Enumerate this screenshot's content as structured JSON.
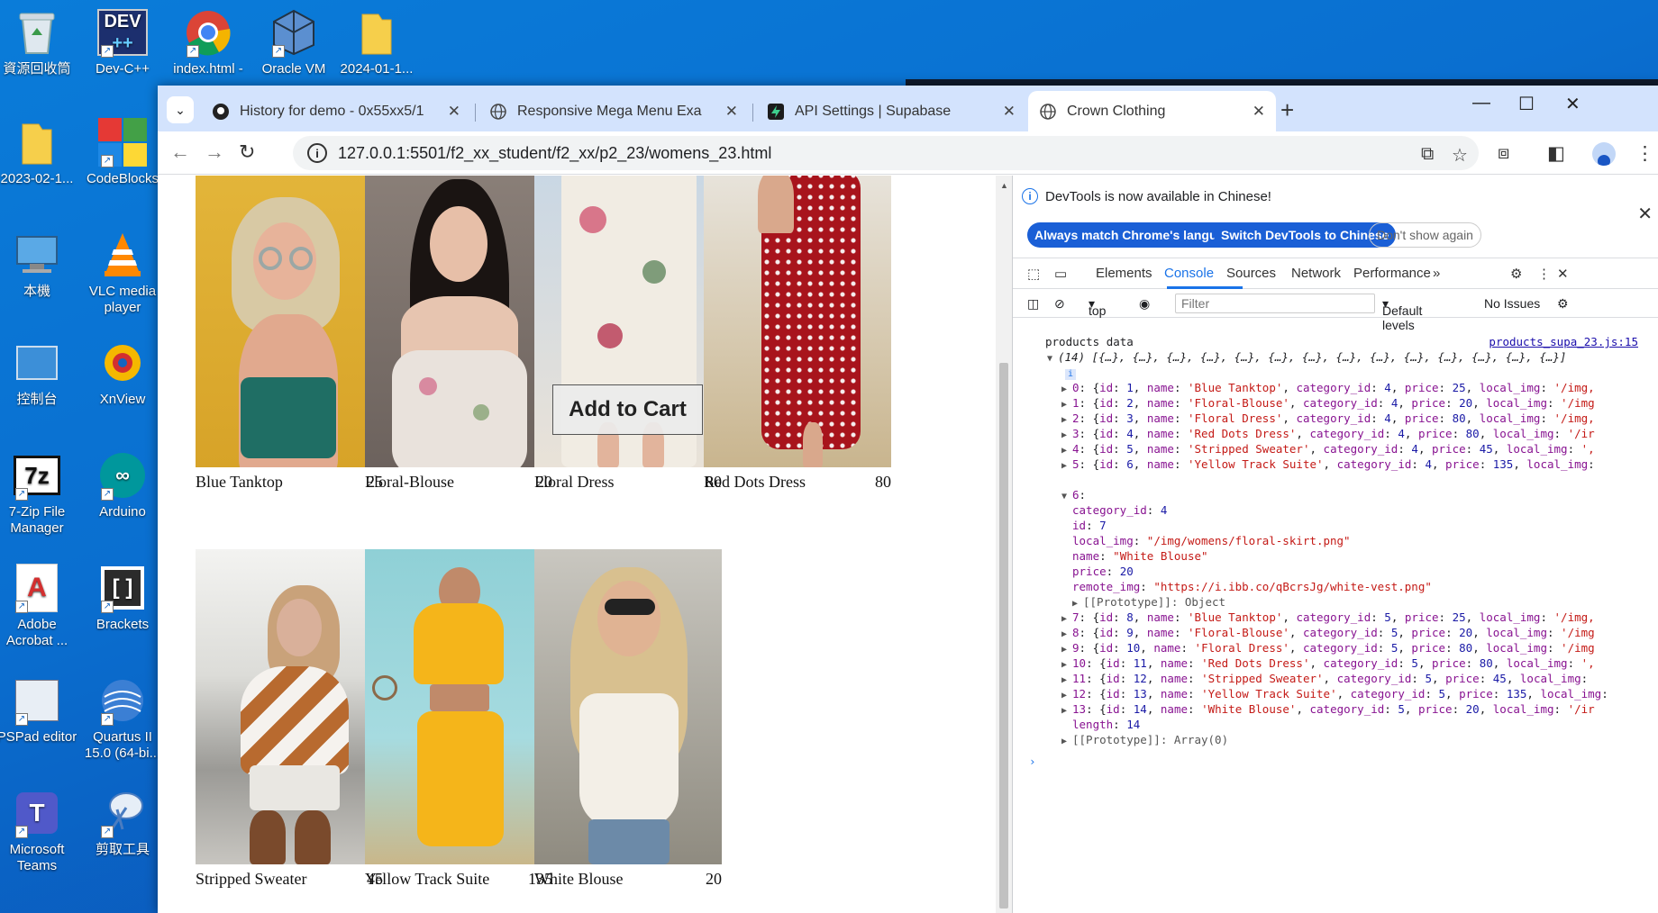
{
  "desktop": {
    "icons": [
      {
        "label": "資源回收筒",
        "icon": "recycle-bin-icon"
      },
      {
        "label": "Dev-C++",
        "icon": "devcpp-icon"
      },
      {
        "label": "index.html - 捷徑",
        "icon": "chrome-icon"
      },
      {
        "label": "Oracle VM VirtualBox",
        "icon": "virtualbox-icon"
      },
      {
        "label": "2024-01-1...",
        "icon": "folder-icon"
      },
      {
        "label": "2023-02-1...",
        "icon": "folder-icon"
      },
      {
        "label": "CodeBlocks",
        "icon": "codeblocks-icon"
      },
      {
        "label": "本機",
        "icon": "computer-icon"
      },
      {
        "label": "VLC media player",
        "icon": "vlc-icon"
      },
      {
        "label": "控制台",
        "icon": "control-panel-icon"
      },
      {
        "label": "XnView",
        "icon": "xnview-icon"
      },
      {
        "label": "7-Zip File Manager",
        "icon": "7zip-icon"
      },
      {
        "label": "Arduino",
        "icon": "arduino-icon"
      },
      {
        "label": "Adobe Acrobat ...",
        "icon": "acrobat-icon"
      },
      {
        "label": "Brackets",
        "icon": "brackets-icon"
      },
      {
        "label": "PSPad editor",
        "icon": "pspad-icon"
      },
      {
        "label": "Quartus II 15.0 (64-bi...",
        "icon": "quartus-icon"
      },
      {
        "label": "Microsoft Teams",
        "icon": "teams-icon"
      },
      {
        "label": "剪取工具",
        "icon": "snipping-tool-icon"
      }
    ]
  },
  "browser": {
    "tabs": [
      {
        "title": "History for demo - 0x55xx5/1",
        "icon": "github-icon"
      },
      {
        "title": "Responsive Mega Menu Exam",
        "icon": "globe-icon"
      },
      {
        "title": "API Settings | Supabase",
        "icon": "supabase-icon"
      },
      {
        "title": "Crown Clothing",
        "icon": "globe-icon",
        "active": true
      }
    ],
    "url": "127.0.0.1:5501/f2_xx_student/f2_xx/p2_23/womens_23.html"
  },
  "products": [
    {
      "name": "Blue Tanktop",
      "price": "25"
    },
    {
      "name": "Floral-Blouse",
      "price": "20"
    },
    {
      "name": "Floral Dress",
      "price": "80"
    },
    {
      "name": "Red Dots Dress",
      "price": "80"
    },
    {
      "name": "Stripped Sweater",
      "price": "45"
    },
    {
      "name": "Yellow Track Suite",
      "price": "135"
    },
    {
      "name": "White Blouse",
      "price": "20"
    }
  ],
  "add_to_cart": "Add to Cart",
  "devtools": {
    "banner": "DevTools is now available in Chinese!",
    "btn_match": "Always match Chrome's language",
    "btn_switch": "Switch DevTools to Chinese",
    "btn_dismiss": "Don't show again",
    "tabs": [
      "Elements",
      "Console",
      "Sources",
      "Network",
      "Performance"
    ],
    "context": "top",
    "filter_placeholder": "Filter",
    "levels": "Default levels",
    "issues": "No Issues",
    "console": {
      "label": "products data",
      "source": "products_supa_23.js:15",
      "array_summary": "(14) [{…}, {…}, {…}, {…}, {…}, {…}, {…}, {…}, {…}, {…}, {…}, {…}, {…}, {…}]",
      "info_badge": "i",
      "length": "14",
      "proto_array": "[[Prototype]]: Array(0)",
      "proto_object": "[[Prototype]]: Object",
      "rows_a": [
        {
          "idx": "0",
          "id": "1",
          "name": "Blue Tanktop",
          "cat": "4",
          "price": "25",
          "tail": "'/img,"
        },
        {
          "idx": "1",
          "id": "2",
          "name": "Floral-Blouse",
          "cat": "4",
          "price": "20",
          "tail": "'/img"
        },
        {
          "idx": "2",
          "id": "3",
          "name": "Floral Dress",
          "cat": "4",
          "price": "80",
          "tail": "'/img,"
        },
        {
          "idx": "3",
          "id": "4",
          "name": "Red Dots Dress",
          "cat": "4",
          "price": "80",
          "tail": "'/ir"
        },
        {
          "idx": "4",
          "id": "5",
          "name": "Stripped Sweater",
          "cat": "4",
          "price": "45",
          "tail": "',"
        },
        {
          "idx": "5",
          "id": "6",
          "name": "Yellow Track Suite",
          "cat": "4",
          "price": "135",
          "tail": ""
        }
      ],
      "expanded": {
        "idx": "6",
        "category_id": "4",
        "id": "7",
        "local_img": "\"/img/womens/floral-skirt.png\"",
        "name": "\"White Blouse\"",
        "price": "20",
        "remote_img": "\"https://i.ibb.co/qBcrsJg/white-vest.png\""
      },
      "rows_b": [
        {
          "idx": "7",
          "id": "8",
          "name": "Blue Tanktop",
          "cat": "5",
          "price": "25",
          "tail": "'/img,"
        },
        {
          "idx": "8",
          "id": "9",
          "name": "Floral-Blouse",
          "cat": "5",
          "price": "20",
          "tail": "'/img"
        },
        {
          "idx": "9",
          "id": "10",
          "name": "Floral Dress",
          "cat": "5",
          "price": "80",
          "tail": "'/img"
        },
        {
          "idx": "10",
          "id": "11",
          "name": "Red Dots Dress",
          "cat": "5",
          "price": "80",
          "tail": "',"
        },
        {
          "idx": "11",
          "id": "12",
          "name": "Stripped Sweater",
          "cat": "5",
          "price": "45",
          "tail": ""
        },
        {
          "idx": "12",
          "id": "13",
          "name": "Yellow Track Suite",
          "cat": "5",
          "price": "135",
          "tail": ""
        },
        {
          "idx": "13",
          "id": "14",
          "name": "White Blouse",
          "cat": "5",
          "price": "20",
          "tail": "'/ir"
        }
      ]
    }
  },
  "colors": {
    "accent": "#1a73e8",
    "tabbar": "#d3e3fd",
    "desktop": "#0a6fd0"
  }
}
